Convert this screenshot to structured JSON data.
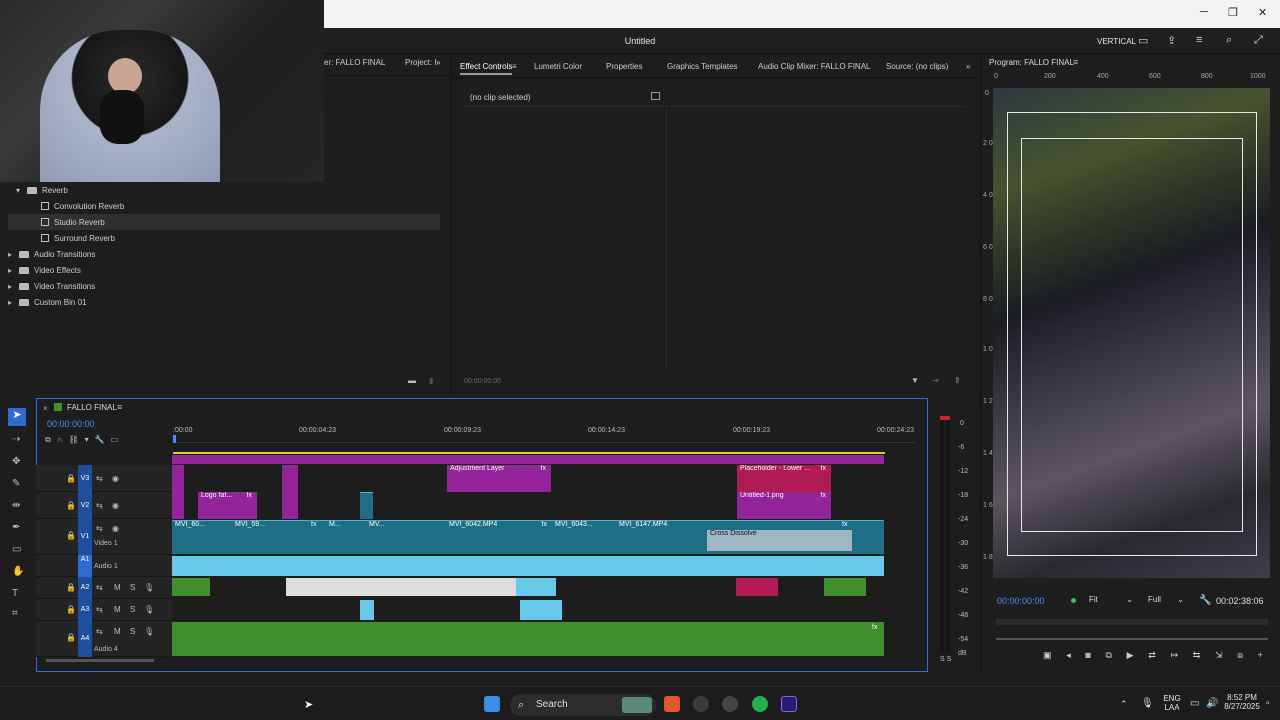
{
  "app": {
    "title": "Untitled",
    "workspace_label": "VERTICAL"
  },
  "project_panel": {
    "tabs": [
      "er: FALLO FINAL",
      "Project: I"
    ],
    "tree": [
      {
        "label": "Reverb",
        "type": "folder",
        "expanded": true
      },
      {
        "label": "Convolution Reverb",
        "type": "effect"
      },
      {
        "label": "Studio Reverb",
        "type": "effect",
        "selected": true
      },
      {
        "label": "Surround Reverb",
        "type": "effect"
      },
      {
        "label": "Audio Transitions",
        "type": "folder"
      },
      {
        "label": "Video Effects",
        "type": "folder"
      },
      {
        "label": "Video Transitions",
        "type": "folder"
      },
      {
        "label": "Custom Bin 01",
        "type": "folder"
      }
    ]
  },
  "effect_panel": {
    "tabs": [
      "Effect Controls",
      "Lumetri Color",
      "Properties",
      "Graphics Templates",
      "Audio Clip Mixer: FALLO FINAL",
      "Source: (no clips)"
    ],
    "no_clip_text": "(no clip selected)",
    "timecode": "00:00:00:00"
  },
  "program_monitor": {
    "title": "Program: FALLO FINAL",
    "ruler_ticks": [
      "0",
      "200",
      "400",
      "600",
      "800",
      "1000"
    ],
    "left_ruler": [
      "0",
      "2 0",
      "4 0",
      "6 0",
      "8 0",
      "1 0",
      "1 2",
      "1 4",
      "1 6",
      "1 8"
    ],
    "timecode": "00:00:00:00",
    "fit": "Fit",
    "quality": "Full",
    "duration": "00:02:38:06"
  },
  "timeline": {
    "sequence_name": "FALLO FINAL",
    "timecode": "00:00:00:00",
    "ruler_labels": [
      ":00:00",
      "00:00:04:23",
      "00:00:09:23",
      "00:00:14:23",
      "00:00:19:23",
      "00:00:24:23"
    ],
    "tracks": {
      "v3": "V3",
      "v2": "V2",
      "v1": "V1",
      "video1": "Video 1",
      "a1": "A1",
      "a2": "A2",
      "a3": "A3",
      "a4": "A4",
      "audio1": "Audio 1",
      "audio4": "Audio 4",
      "src_a1": "A1"
    },
    "clips": {
      "adjustment": "Adjustment Layer",
      "placeholder": "Placeholder - Lower ...",
      "logo": "Logo faf...",
      "untitled": "Untitled-1.png",
      "mvi60": "MVI_60...",
      "mvi59": "MVI_59...",
      "m": "M...",
      "mv": "MV...",
      "mvi6042": "MVI_6042.MP4",
      "mvi6043": "MVI_6043...",
      "mvi6147": "MVI_6147.MP4",
      "cross_dissolve": "Cross Dissolve"
    },
    "fx_label": "fx",
    "m_label": "M",
    "s_label": "S"
  },
  "meters": {
    "scale": [
      "0",
      "-6",
      "-12",
      "-18",
      "-24",
      "-30",
      "-36",
      "-42",
      "-48",
      "-54",
      "dB"
    ],
    "footer": "S S"
  },
  "taskbar": {
    "search_label": "Search",
    "lang_line1": "ENG",
    "lang_line2": "LAA",
    "time": "8:52 PM",
    "date": "8/27/2025"
  }
}
